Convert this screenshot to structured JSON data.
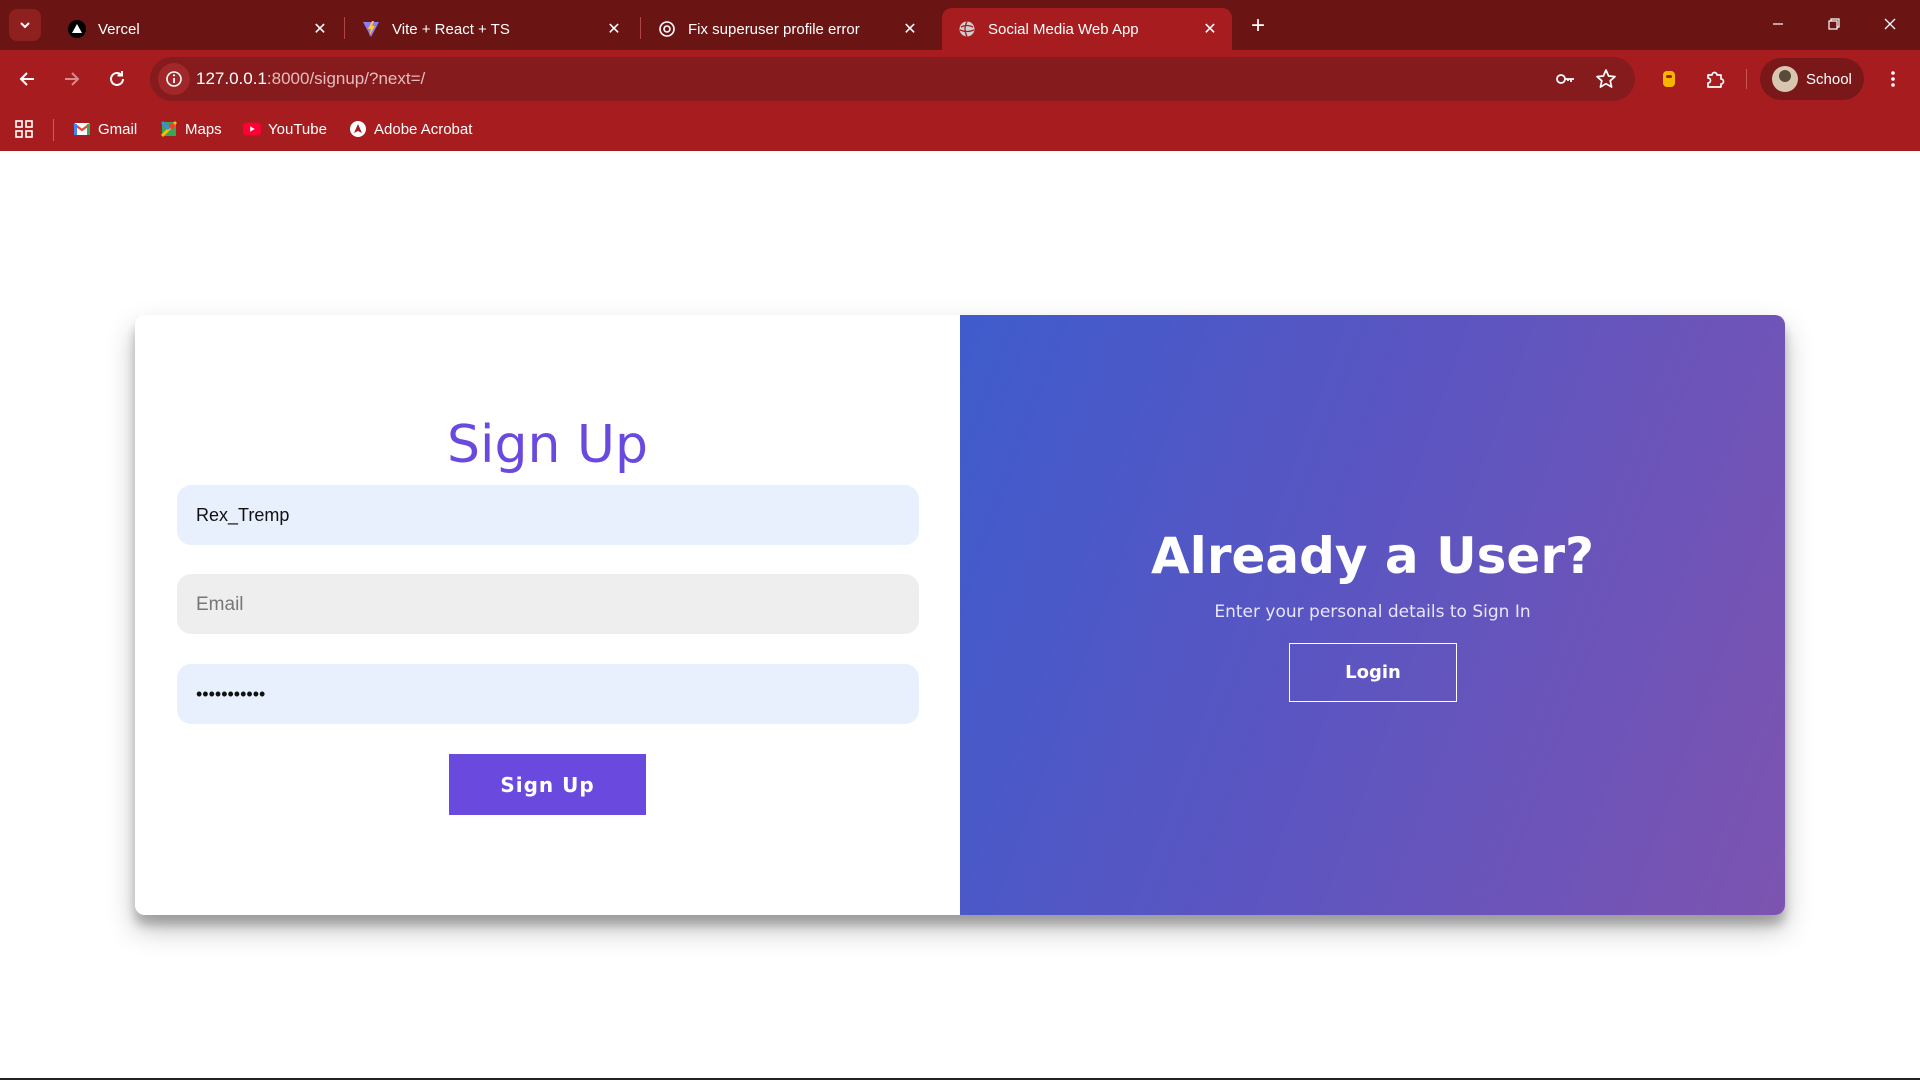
{
  "browser": {
    "tabs": [
      {
        "title": "Vercel",
        "icon": "vercel-triangle-icon"
      },
      {
        "title": "Vite + React + TS",
        "icon": "vite-icon"
      },
      {
        "title": "Fix superuser profile error",
        "icon": "openai-icon"
      },
      {
        "title": "Social Media Web App",
        "icon": "globe-icon",
        "active": true
      }
    ],
    "address_bar": {
      "host": "127.0.0.1",
      "rest": ":8000/signup/?next=/"
    },
    "profile": {
      "name": "School"
    },
    "bookmarks": [
      {
        "label": "Gmail",
        "icon": "gmail-icon"
      },
      {
        "label": "Maps",
        "icon": "maps-icon"
      },
      {
        "label": "YouTube",
        "icon": "youtube-icon"
      },
      {
        "label": "Adobe Acrobat",
        "icon": "acrobat-icon"
      }
    ]
  },
  "signup": {
    "title": "Sign Up",
    "username_value": "Rex_Tremp",
    "email_placeholder": "Email",
    "password_value": "•••••••••••",
    "button_label": "Sign Up"
  },
  "login_panel": {
    "title": "Already a User?",
    "subtitle": "Enter your personal details to Sign In",
    "button_label": "Login"
  },
  "colors": {
    "chrome_dark": "#6b1414",
    "chrome": "#a71d1f",
    "accent": "#6a4ade",
    "gradient_start": "#3f5ccc",
    "gradient_end": "#7d54b0"
  }
}
